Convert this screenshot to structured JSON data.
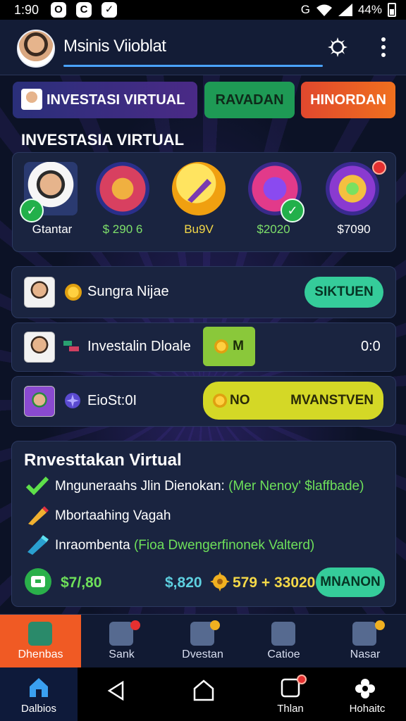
{
  "status_bar": {
    "time": "1:90",
    "battery": "44%",
    "left_icons": [
      "O",
      "C",
      "✓"
    ],
    "right_signal_icon": "G"
  },
  "header": {
    "user_name": "Msinis Viioblat"
  },
  "tabs": [
    {
      "label": "INVESTASI VIRTUAL"
    },
    {
      "label": "RAVADAN"
    },
    {
      "label": "HINORDAN"
    }
  ],
  "featured": {
    "title": "INVESTASIA VIRTUAL",
    "items": [
      {
        "label": "Gtantar",
        "icon": "person-icon"
      },
      {
        "label": "$ 290 6",
        "icon": "house-icon"
      },
      {
        "label": "Bu9V",
        "icon": "pen-icon"
      },
      {
        "label": "$2020",
        "icon": "ticket-icon"
      },
      {
        "label": "$7090",
        "icon": "target-icon"
      }
    ]
  },
  "rows": [
    {
      "label": "Sungra Nijae",
      "button": "SIKTUEN"
    },
    {
      "label": "Investalin Dloale",
      "button": "M",
      "value": "0:0"
    },
    {
      "label": "EioSt:0I",
      "button_left": "NO",
      "button": "MVANSTVEN"
    }
  ],
  "investment": {
    "title": "Rnvesttakan Virtual",
    "lines": [
      {
        "text": "Mnguneraahs Jlin Dienokan:",
        "highlight": "(Mer Nenoy' $laffbade)"
      },
      {
        "text": "Mbortaahing Vagah",
        "highlight": ""
      },
      {
        "text": "Inraombenta",
        "highlight": "(Fioa Dwengerfinonek Valterd)"
      }
    ],
    "amounts": {
      "amount_1": "$7/,80",
      "amount_2": "$,820",
      "amount_3": "579 + 33020",
      "button": "MNANON"
    }
  },
  "bottom_nav": [
    {
      "label": "Dhenbas",
      "active": true
    },
    {
      "label": "Sank"
    },
    {
      "label": "Dvestan"
    },
    {
      "label": "Catioe"
    },
    {
      "label": "Nasar"
    }
  ],
  "system_nav": [
    {
      "label": "Dalbios"
    },
    {
      "label": ""
    },
    {
      "label": ""
    },
    {
      "label": "Thlan"
    },
    {
      "label": "Hohaitc"
    }
  ],
  "colors": {
    "background": "#0c1226",
    "accent_blue": "#4aa3ff",
    "green": "#1e9a55",
    "orange": "#f05a24",
    "lime": "#d4d826",
    "teal_button": "#35cc9a"
  }
}
